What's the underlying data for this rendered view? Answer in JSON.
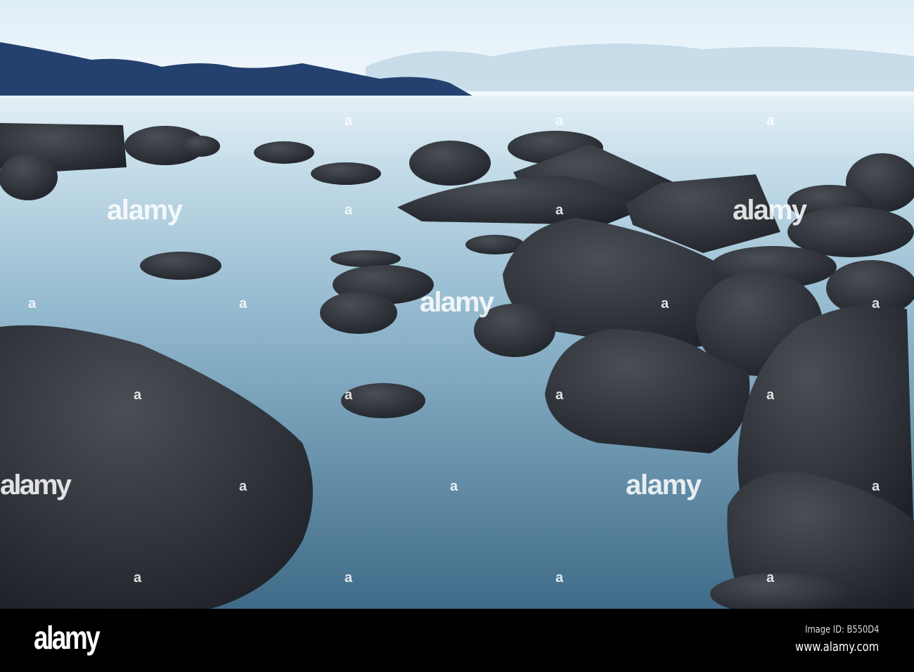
{
  "photo": {
    "subject": "Long-exposure rocky seashore at dusk",
    "colors": {
      "sky": "#e9f2f8",
      "mountains": "#24406e",
      "sea": "#7fa8c2",
      "rocks": "#2b2f36"
    }
  },
  "watermark": {
    "text": "alamy",
    "mark": "a"
  },
  "footer": {
    "logo": "alamy",
    "image_id": "Image ID: B550D4",
    "url": "www.alamy.com"
  }
}
